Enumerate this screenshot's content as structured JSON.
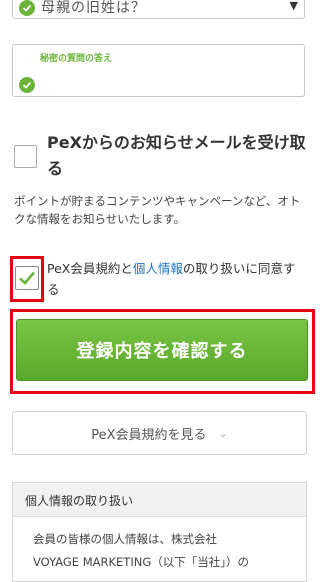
{
  "marital_select": {
    "value": "母親の旧姓は？",
    "arrow": "▼"
  },
  "secret_answer": {
    "label": "秘密の質問の答え"
  },
  "newsletter": {
    "title": "PeXからのお知らせメールを受け取る",
    "description": "ポイントが貯まるコンテンツやキャンペーンなど、オトクな情報をお知らせいたします。"
  },
  "terms": {
    "checked": true,
    "text_before": "PeX会員規約と",
    "link_text": "個人情報",
    "text_after": "の取り扱いに同意する"
  },
  "confirm_button": {
    "label": "登録内容を確認する"
  },
  "view_terms_button": {
    "label": "PeX会員規約を見る",
    "chevron": "⌄"
  },
  "privacy": {
    "header": "個人情報の取り扱い",
    "line1": "会員の皆様の個人情報は、株式会社",
    "line2": "VOYAGE MARKETING（以下「当社」）の"
  },
  "colors": {
    "accent_green": "#6bb43a",
    "highlight_red": "#e60012",
    "link_blue": "#1a73c7"
  }
}
